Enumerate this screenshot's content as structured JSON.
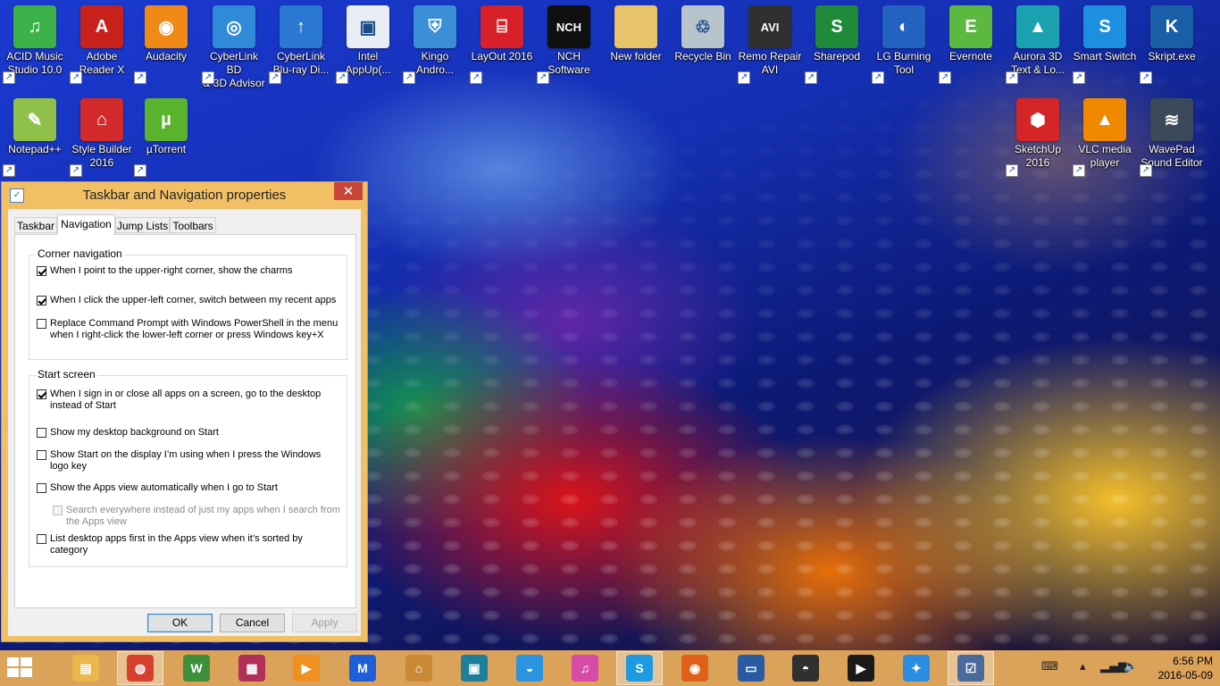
{
  "desktop": {
    "icons": [
      {
        "label": "ACID Music\nStudio 10.0",
        "icon": "acid-music-icon",
        "glyph": "♫",
        "color": "#3db248"
      },
      {
        "label": "Adobe\nReader X",
        "icon": "adobe-reader-icon",
        "glyph": "A",
        "color": "#c8201a"
      },
      {
        "label": "Audacity",
        "icon": "audacity-icon",
        "glyph": "◉",
        "color": "#f08a16"
      },
      {
        "label": "CyberLink BD\n& 3D Advisor",
        "icon": "cyberlink-advisor-icon",
        "glyph": "◎",
        "color": "#2f8ad8"
      },
      {
        "label": "CyberLink\nBlu-ray Di...",
        "icon": "cyberlink-bluray-icon",
        "glyph": "↑",
        "color": "#2a78d0"
      },
      {
        "label": "Intel\nAppUp(...",
        "icon": "intel-appup-icon",
        "glyph": "▣",
        "color": "#e8eef4"
      },
      {
        "label": "Kingo\nAndro...",
        "icon": "kingo-android-icon",
        "glyph": "⛨",
        "color": "#3a8fd6"
      },
      {
        "label": "LayOut 2016",
        "icon": "layout-icon",
        "glyph": "⌸",
        "color": "#d8202a"
      },
      {
        "label": "NCH\nSoftware",
        "icon": "nch-software-icon",
        "glyph": "NCH",
        "color": "#101010"
      },
      {
        "label": "New folder",
        "icon": "folder-icon",
        "glyph": "",
        "color": "#e7c36a"
      },
      {
        "label": "Recycle Bin",
        "icon": "recycle-bin-icon",
        "glyph": "♲",
        "color": "#b8c4cc"
      },
      {
        "label": "Remo Repair\nAVI",
        "icon": "remo-repair-icon",
        "glyph": "AVI",
        "color": "#303030"
      },
      {
        "label": "Sharepod",
        "icon": "sharepod-icon",
        "glyph": "S",
        "color": "#1f8a3a"
      },
      {
        "label": "LG Burning\nTool",
        "icon": "lg-burning-icon",
        "glyph": "◐",
        "color": "#2462c0"
      },
      {
        "label": "Evernote",
        "icon": "evernote-icon",
        "glyph": "E",
        "color": "#5cb83e"
      },
      {
        "label": "Aurora 3D\nText & Lo...",
        "icon": "aurora-3d-icon",
        "glyph": "▲",
        "color": "#1aa2b0"
      },
      {
        "label": "Smart Switch",
        "icon": "smart-switch-icon",
        "glyph": "S",
        "color": "#1d8fe0"
      },
      {
        "label": "Skript.exe",
        "icon": "skript-icon",
        "glyph": "K",
        "color": "#1b5ea8"
      },
      {
        "label": "Notepad++",
        "icon": "notepad-plus-plus-icon",
        "glyph": "✎",
        "color": "#8fc14a"
      },
      {
        "label": "Style Builder\n2016",
        "icon": "style-builder-icon",
        "glyph": "⌂",
        "color": "#d22a2a"
      },
      {
        "label": "µTorrent",
        "icon": "utorrent-icon",
        "glyph": "µ",
        "color": "#59b32d"
      },
      {
        "label": "SketchUp\n2016",
        "icon": "sketchup-icon",
        "glyph": "⬢",
        "color": "#d42626"
      },
      {
        "label": "VLC media\nplayer",
        "icon": "vlc-icon",
        "glyph": "▲",
        "color": "#f08800"
      },
      {
        "label": "WavePad\nSound Editor",
        "icon": "wavepad-icon",
        "glyph": "≋",
        "color": "#3b4a5a"
      }
    ]
  },
  "dialog": {
    "title": "Taskbar and Navigation properties",
    "close_glyph": "✕",
    "app_glyph": "✓",
    "tabs": [
      "Taskbar",
      "Navigation",
      "Jump Lists",
      "Toolbars"
    ],
    "corner": {
      "title": "Corner navigation",
      "options": [
        {
          "label": "When I point to the upper-right corner, show the charms",
          "checked": true
        },
        {
          "label": "When I click the upper-left corner, switch between my recent apps",
          "checked": true
        },
        {
          "label": "Replace Command Prompt with Windows PowerShell in the menu when I right-click the lower-left corner or press Windows key+X",
          "checked": false
        }
      ]
    },
    "start": {
      "title": "Start screen",
      "options": [
        {
          "label": "When I sign in or close all apps on a screen, go to the desktop instead of Start",
          "checked": true
        },
        {
          "label": "Show my desktop background on Start",
          "checked": false
        },
        {
          "label": "Show Start on the display I’m using when I press the Windows logo key",
          "checked": false
        },
        {
          "label": "Show the Apps view automatically when I go to Start",
          "checked": false
        },
        {
          "label": "Search everywhere instead of just my apps when I search from the Apps view",
          "checked": false,
          "disabled": true
        },
        {
          "label": "List desktop apps first in the Apps view when it’s sorted by category",
          "checked": false
        }
      ]
    },
    "buttons": {
      "ok": "OK",
      "cancel": "Cancel",
      "apply": "Apply"
    }
  },
  "taskbar": {
    "apps": [
      {
        "icon": "file-explorer-icon",
        "glyph": "▤",
        "color": "#e8b84a"
      },
      {
        "icon": "chrome-icon",
        "glyph": "◍",
        "color": "#d8402e",
        "active": true
      },
      {
        "icon": "winamp-icon",
        "glyph": "W",
        "color": "#3d8f3a"
      },
      {
        "icon": "winrar-icon",
        "glyph": "▦",
        "color": "#b03058"
      },
      {
        "icon": "media-player-icon",
        "glyph": "▶",
        "color": "#f09020"
      },
      {
        "icon": "malwarebytes-icon",
        "glyph": "M",
        "color": "#1d5fd8"
      },
      {
        "icon": "bank-icon",
        "glyph": "⌂",
        "color": "#c88a34"
      },
      {
        "icon": "video-editor-icon",
        "glyph": "▣",
        "color": "#1d7f9a"
      },
      {
        "icon": "qq-icon",
        "glyph": "◒",
        "color": "#2a94e0"
      },
      {
        "icon": "itunes-icon",
        "glyph": "♫",
        "color": "#d84aa8"
      },
      {
        "icon": "skype-icon",
        "glyph": "S",
        "color": "#1d9ae0",
        "active": true
      },
      {
        "icon": "firefox-icon",
        "glyph": "◉",
        "color": "#e0601a"
      },
      {
        "icon": "remote-desktop-icon",
        "glyph": "▭",
        "color": "#2a5aa0"
      },
      {
        "icon": "vlc-style-icon",
        "glyph": "◓",
        "color": "#303030"
      },
      {
        "icon": "video-player-icon",
        "glyph": "▶",
        "color": "#1a1a1a"
      },
      {
        "icon": "safari-icon",
        "glyph": "✦",
        "color": "#2a8ee0"
      },
      {
        "icon": "taskbar-properties-icon",
        "glyph": "☑",
        "color": "#4a6a9a",
        "active": true
      }
    ],
    "clock_time": "6:56 PM",
    "clock_date": "2016-05-09"
  }
}
